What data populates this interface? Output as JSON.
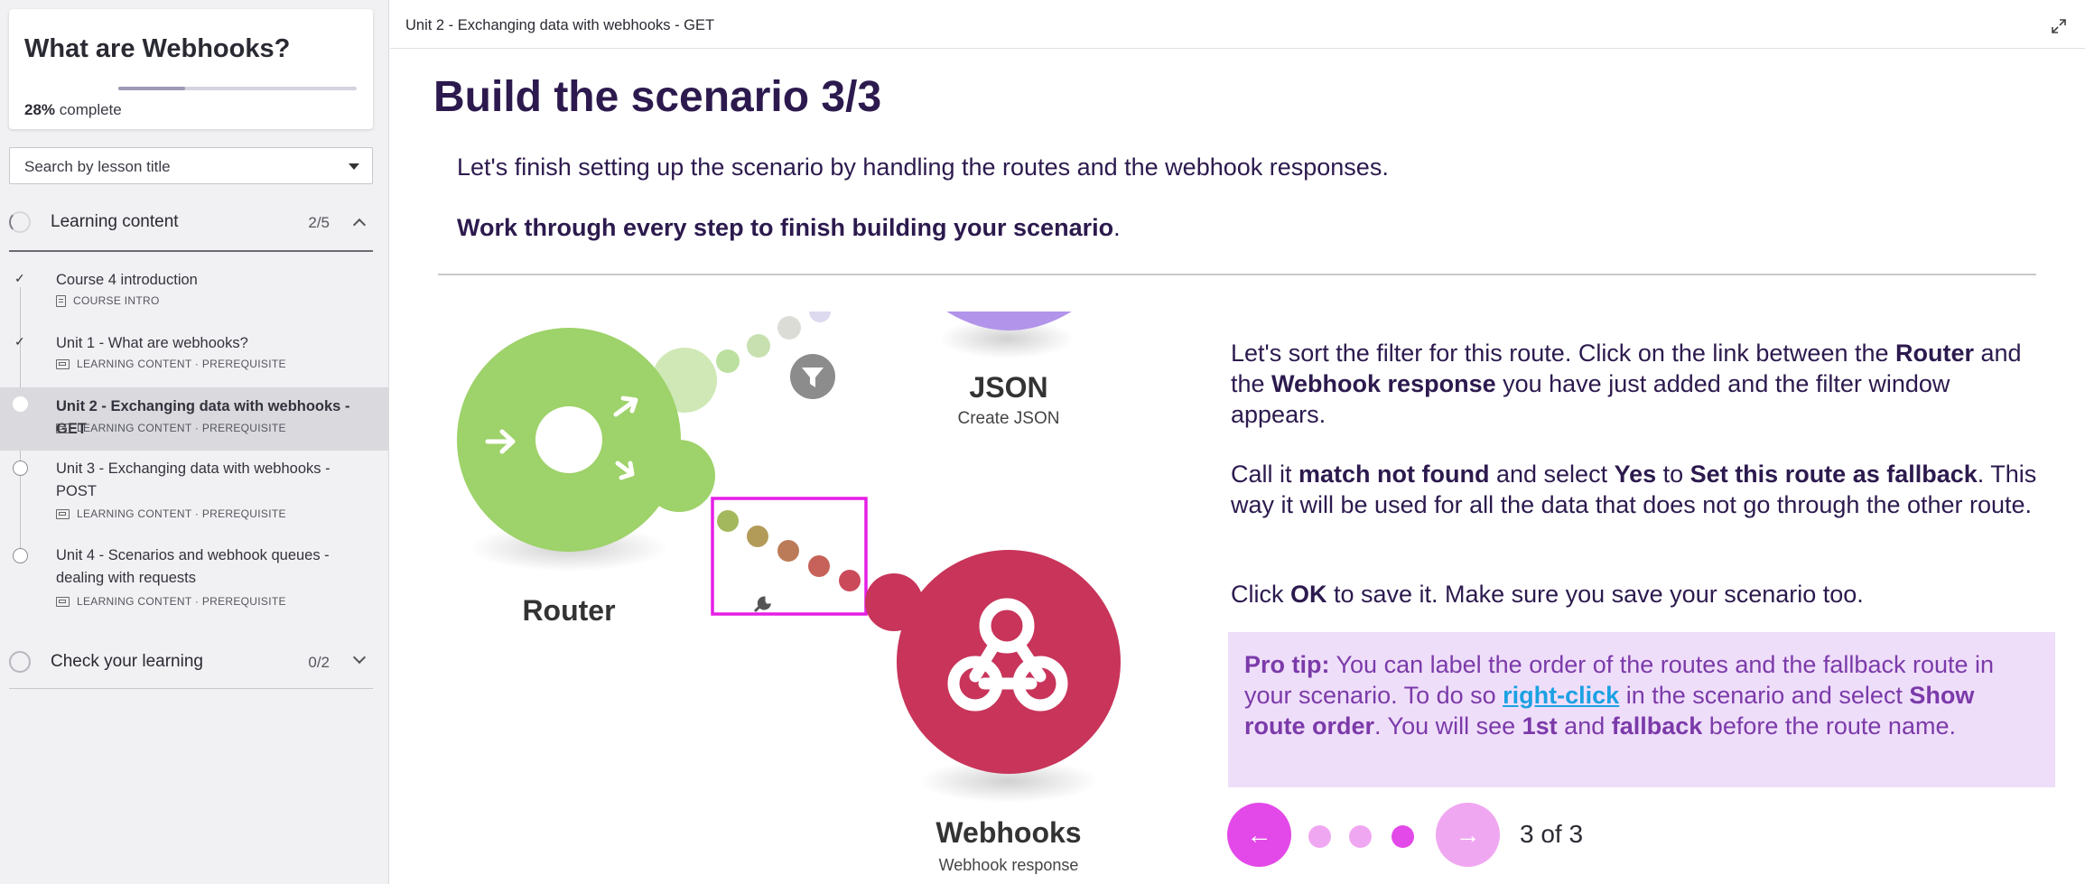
{
  "sidebar": {
    "course_title": "What are Webhooks?",
    "progress_percent": 28,
    "progress_value": "28%",
    "progress_suffix": " complete",
    "search_placeholder": "Search by lesson title",
    "sections": [
      {
        "label": "Learning content",
        "count": "2/5",
        "expanded": true
      },
      {
        "label": "Check your learning",
        "count": "0/2",
        "expanded": false
      }
    ],
    "lessons": [
      {
        "title": "Course 4 introduction",
        "meta": "COURSE INTRO",
        "status": "done"
      },
      {
        "title": "Unit 1 - What are webhooks?",
        "meta": "LEARNING CONTENT · PREREQUISITE",
        "status": "done"
      },
      {
        "title": "Unit 2 - Exchanging data with webhooks - GET",
        "meta": "LEARNING CONTENT · PREREQUISITE",
        "status": "current"
      },
      {
        "title": "Unit 3 - Exchanging data with webhooks - POST",
        "meta": "LEARNING CONTENT · PREREQUISITE",
        "status": "todo"
      },
      {
        "title": "Unit 4 - Scenarios and webhook queues - dealing with requests",
        "meta": "LEARNING CONTENT · PREREQUISITE",
        "status": "todo"
      }
    ]
  },
  "topbar": {
    "breadcrumb": "Unit 2 - Exchanging data with webhooks - GET"
  },
  "main": {
    "title": "Build the scenario 3/3",
    "intro": "Let's finish setting up the scenario by handling the routes and the webhook responses.",
    "intro_bold": "Work through every step to finish building your scenario",
    "intro_end": ".",
    "figure": {
      "router_label": "Router",
      "json_label": "JSON",
      "json_sub": "Create JSON",
      "webhooks_label": "Webhooks",
      "webhooks_sub": "Webhook response"
    },
    "para1": {
      "t1": "Let's sort the filter for this route. Click on the link between the ",
      "b1": "Router",
      "t2": " and the ",
      "b2": "Webhook response",
      "t3": " you have just added and the filter window appears."
    },
    "para2": {
      "t1": "Call it ",
      "b1": "match not found",
      "t2": " and select ",
      "b2": "Yes",
      "t3": " to ",
      "b3": "Set this route as fallback",
      "t4": ". This way it will be used for all the data that does not go through the other route."
    },
    "para3": {
      "t1": "Click ",
      "b1": "OK",
      "t2": " to save it. Make sure you save your scenario too."
    },
    "protip": {
      "label": "Pro tip:",
      "t1": " You can label the order of the routes and the fallback route in your scenario. To do so ",
      "link": "right-click",
      "t2": " in the scenario and select ",
      "b1": "Show route order",
      "t3": ". You will see ",
      "b2": "1st",
      "t4": " and ",
      "b3": "fallback",
      "t5": " before the route name."
    },
    "pager": {
      "text": "3 of 3",
      "current": 3,
      "total": 3
    }
  },
  "colors": {
    "accent": "#e349e8",
    "accent_light": "#f0a7f1",
    "title": "#2c1a4e",
    "protip_bg": "#efdefa",
    "protip_text": "#7b3aa9",
    "link": "#1ba1e2",
    "router_green": "#9ed26a",
    "webhook_red": "#c8345a",
    "highlight_box": "#e61ee6"
  },
  "icons": [
    "chevron-up-icon",
    "chevron-down-icon",
    "expand-icon",
    "check-icon",
    "arrow-left-icon",
    "arrow-right-icon",
    "filter-icon",
    "wrench-icon",
    "webhook-icon",
    "router-icon"
  ]
}
